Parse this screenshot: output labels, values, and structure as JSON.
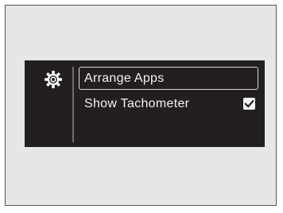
{
  "menu": {
    "settings_icon": "gear-icon",
    "items": [
      {
        "label": "Arrange Apps",
        "selected": true
      },
      {
        "label": "Show Tachometer",
        "checked": true
      }
    ]
  },
  "colors": {
    "panel_bg": "#231f20",
    "text": "#f2f2f2",
    "frame_bg": "#e6e6e6"
  }
}
